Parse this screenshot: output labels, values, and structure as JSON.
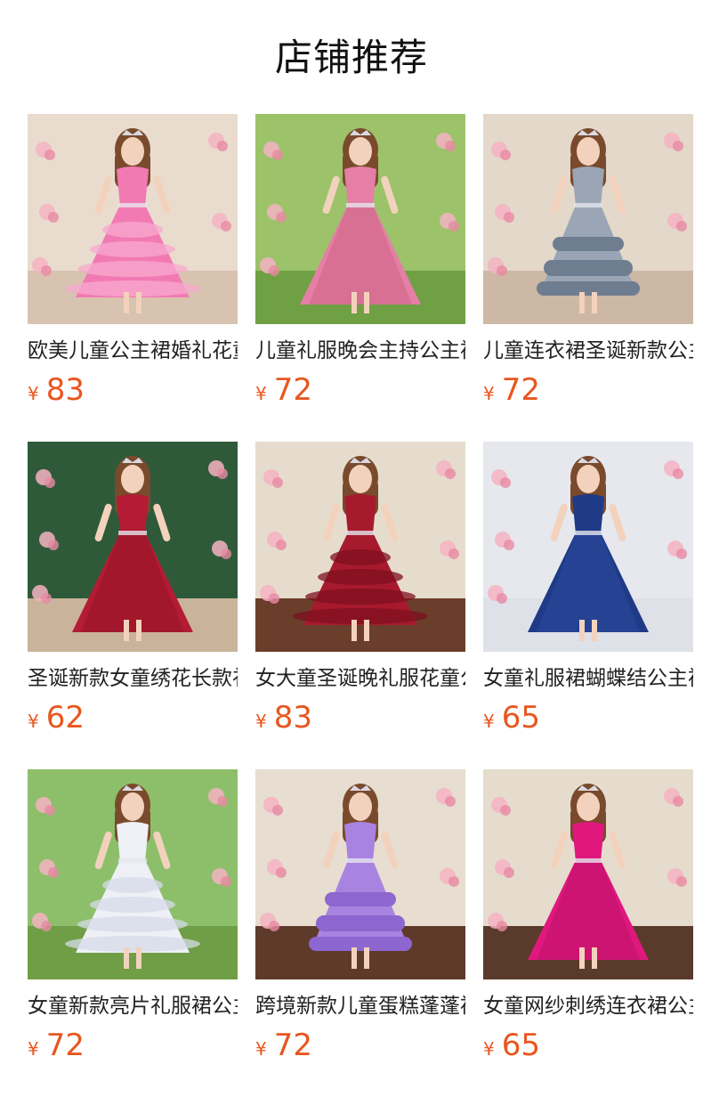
{
  "header": {
    "title": "店铺推荐"
  },
  "currency": "¥",
  "products": [
    {
      "name": "欧美儿童公主裙婚礼花童礼服",
      "price": "83",
      "dress": "#f27ab3",
      "dress2": "#f7a9cf",
      "bg": "#e9dccf",
      "floor": "#d8c3b0",
      "style": "ruffle"
    },
    {
      "name": "儿童礼服晚会主持公主裙",
      "price": "72",
      "dress": "#e57fa6",
      "dress2": "#c8607f",
      "bg": "#9cc36a",
      "floor": "#6fa044",
      "style": "tulle"
    },
    {
      "name": "儿童连衣裙圣诞新款公主裙",
      "price": "72",
      "dress": "#9aa6b6",
      "dress2": "#6f7d90",
      "bg": "#e4d8cb",
      "floor": "#cdb8a6",
      "style": "tiered"
    },
    {
      "name": "圣诞新款女童绣花长款礼服",
      "price": "62",
      "dress": "#b31c34",
      "dress2": "#8e1224",
      "bg": "#2f5a3a",
      "floor": "#c9b39a",
      "style": "tulle"
    },
    {
      "name": "女大童圣诞晚礼服花童公主裙",
      "price": "83",
      "dress": "#a71a2e",
      "dress2": "#7e0f1f",
      "bg": "#e6dccd",
      "floor": "#6a3e2a",
      "style": "ruffle"
    },
    {
      "name": "女童礼服裙蝴蝶结公主裙",
      "price": "65",
      "dress": "#1f3a86",
      "dress2": "#2d4ea3",
      "bg": "#e6e8ee",
      "floor": "#dfe1e8",
      "style": "tulle"
    },
    {
      "name": "女童新款亮片礼服裙公主裙",
      "price": "72",
      "dress": "#eef0f6",
      "dress2": "#d5dbe8",
      "bg": "#8dbf6a",
      "floor": "#6f9e46",
      "style": "ruffle"
    },
    {
      "name": "跨境新款儿童蛋糕蓬蓬裙",
      "price": "72",
      "dress": "#a884e0",
      "dress2": "#8d66cf",
      "bg": "#e7ddd0",
      "floor": "#5e3a2a",
      "style": "tiered"
    },
    {
      "name": "女童网纱刺绣连衣裙公主裙",
      "price": "65",
      "dress": "#e0187e",
      "dress2": "#b80f63",
      "bg": "#e6dccd",
      "floor": "#5a3a2a",
      "style": "tulle"
    }
  ]
}
